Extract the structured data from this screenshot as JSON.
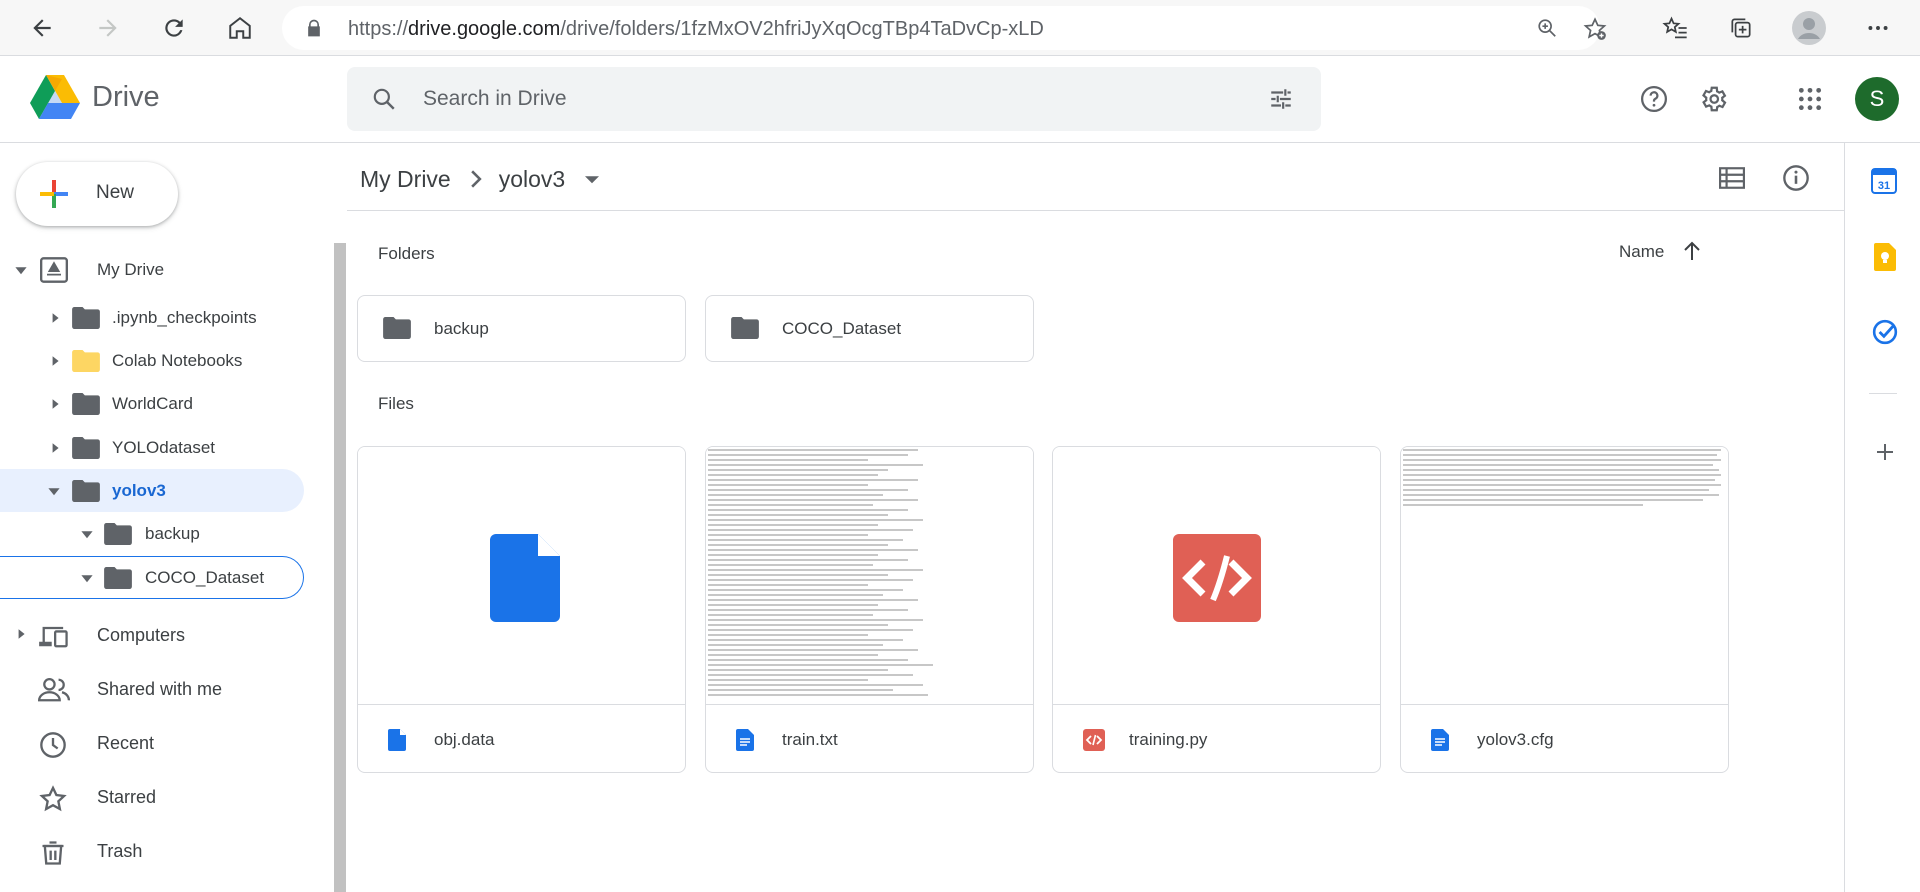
{
  "browser": {
    "url_prefix": "https://",
    "url_host": "drive.google.com",
    "url_path": "/drive/folders/1fzMxOV2hfriJyXqOcgTBp4TaDvCp-xLD"
  },
  "app": {
    "name": "Drive",
    "search_placeholder": "Search in Drive",
    "avatar_letter": "S"
  },
  "sidebar": {
    "new_label": "New",
    "my_drive_label": "My Drive",
    "tree": [
      {
        "label": ".ipynb_checkpoints"
      },
      {
        "label": "Colab Notebooks"
      },
      {
        "label": "WorldCard"
      },
      {
        "label": "YOLOdataset"
      },
      {
        "label": "yolov3"
      },
      {
        "label": "backup"
      },
      {
        "label": "COCO_Dataset"
      }
    ],
    "nav": [
      {
        "label": "Computers"
      },
      {
        "label": "Shared with me"
      },
      {
        "label": "Recent"
      },
      {
        "label": "Starred"
      },
      {
        "label": "Trash"
      }
    ]
  },
  "main": {
    "breadcrumb": [
      {
        "label": "My Drive"
      },
      {
        "label": "yolov3"
      }
    ],
    "folders_title": "Folders",
    "files_title": "Files",
    "sort_label": "Name",
    "folders": [
      {
        "name": "backup"
      },
      {
        "name": "COCO_Dataset"
      }
    ],
    "files": [
      {
        "name": "obj.data"
      },
      {
        "name": "train.txt"
      },
      {
        "name": "training.py"
      },
      {
        "name": "yolov3.cfg"
      }
    ]
  },
  "colors": {
    "accent": "#1a73e8",
    "active_bg": "#e8f0fe",
    "folder_grey": "#5f6368",
    "folder_yellow": "#fdd663",
    "py_red": "#e06055",
    "doc_blue": "#1a73e8"
  }
}
